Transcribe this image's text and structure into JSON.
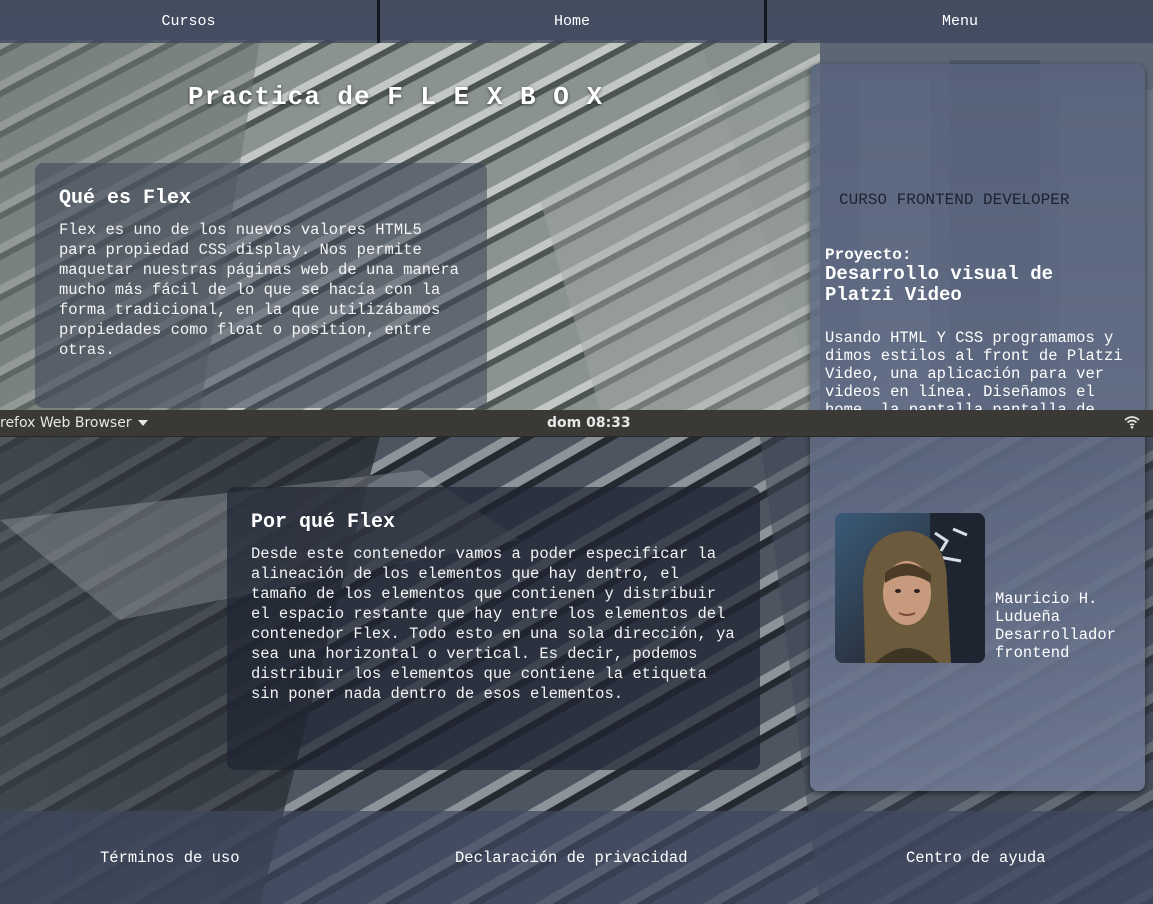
{
  "nav": {
    "items": [
      {
        "label": "Cursos"
      },
      {
        "label": "Home"
      },
      {
        "label": "Menu"
      }
    ]
  },
  "headline": "Practica de F L E X B O X",
  "cards": {
    "flex": {
      "title": "Qué es Flex",
      "body": "Flex es uno de los nuevos valores HTML5 para propiedad CSS display. Nos permite maquetar nuestras páginas web de una manera mucho más fácil de lo que se hacía con la forma tradicional, en la que utilizábamos propiedades como float o position, entre otras."
    },
    "why": {
      "title": "Por qué Flex",
      "body": "Desde este contenedor vamos a poder especificar la alineación de los elementos que hay dentro, el tamaño de los elementos que contienen y distribuir el espacio restante que hay entre los elementos del contenedor Flex. Todo esto en una sola dirección, ya sea una horizontal o vertical. Es decir, podemos distribuir los elementos que contiene la etiqueta sin poner nada dentro de esos elementos."
    }
  },
  "sidebar": {
    "course_title": "CURSO FRONTEND DEVELOPER",
    "project_label": "Proyecto:",
    "project_name": "Desarrollo visual de Platzi Video",
    "project_desc": "Usando HTML Y CSS programamos y dimos estilos al front de Platzi Video, una aplicación para ver videos en línea. Diseñamos el home, la pantalla pantalla de error de esta aplicación web.",
    "author_name": "Mauricio H. Ludueña",
    "author_role": "Desarrollador frontend"
  },
  "systembar": {
    "app_menu": "refox Web Browser",
    "clock": "dom 08:33",
    "icons": [
      "caret-down-icon",
      "wifi-icon"
    ]
  },
  "footer": {
    "links": [
      {
        "label": "Términos de uso"
      },
      {
        "label": "Declaración de privacidad"
      },
      {
        "label": "Centro de ayuda"
      }
    ]
  },
  "colors": {
    "nav_bg": "#3e465c",
    "sidebar_bg": "#58647d",
    "systembar_bg": "#3b3935",
    "course_title": "#1d2230"
  }
}
